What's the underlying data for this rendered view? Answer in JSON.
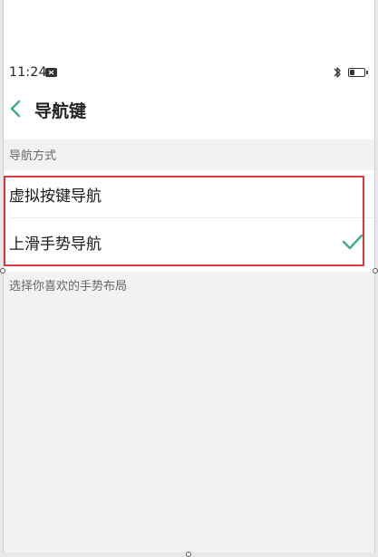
{
  "status_bar": {
    "time": "11:24",
    "notification_icon": "message-icon",
    "bluetooth_icon": "bluetooth-icon",
    "battery_icon": "battery-icon",
    "battery_level": 0.35
  },
  "header": {
    "back_icon": "chevron-left-icon",
    "title": "导航键"
  },
  "sections": {
    "navigation_mode": {
      "title": "导航方式",
      "options": [
        {
          "label": "虚拟按键导航",
          "selected": false
        },
        {
          "label": "上滑手势导航",
          "selected": true
        }
      ]
    },
    "gesture_layout": {
      "title": "选择你喜欢的手势布局"
    }
  },
  "colors": {
    "accent": "#3fae8b",
    "highlight": "#d9393e",
    "section_bg": "#f2f2f2"
  }
}
